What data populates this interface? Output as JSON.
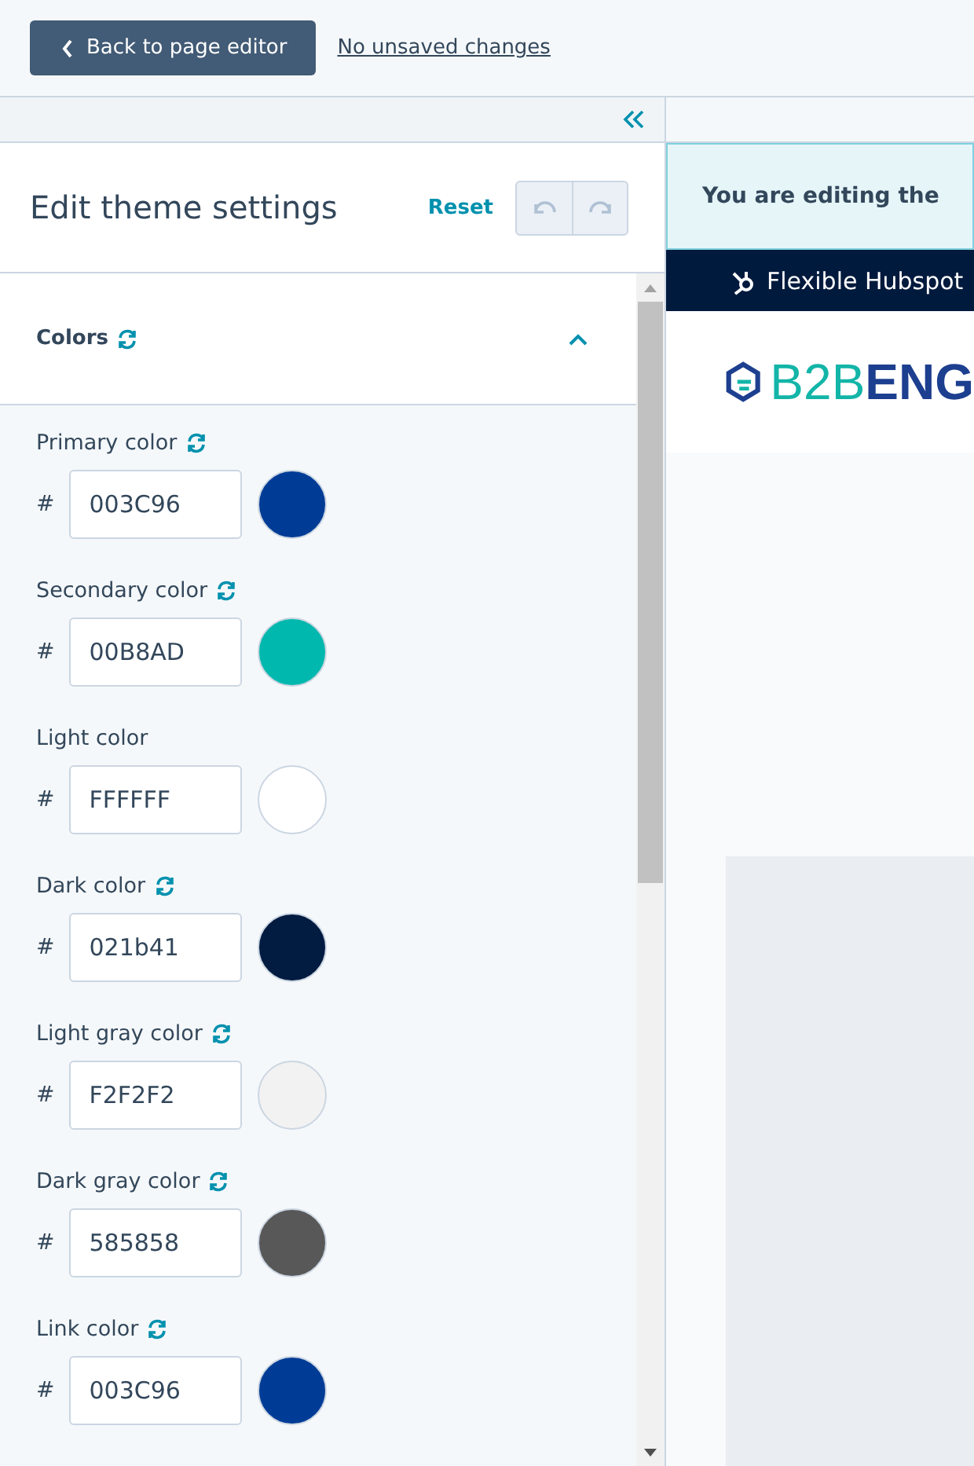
{
  "topbar": {
    "back_button": "Back to page editor",
    "status_link": "No unsaved changes"
  },
  "sidebar": {
    "title": "Edit theme settings",
    "reset": "Reset",
    "section": {
      "label": "Colors",
      "expanded": true
    },
    "settings": [
      {
        "label": "Primary color",
        "value": "003C96",
        "color": "#003c96",
        "resettable": true
      },
      {
        "label": "Secondary color",
        "value": "00B8AD",
        "color": "#00b8ad",
        "resettable": true
      },
      {
        "label": "Light color",
        "value": "FFFFFF",
        "color": "#ffffff",
        "resettable": false
      },
      {
        "label": "Dark color",
        "value": "021b41",
        "color": "#021b41",
        "resettable": true
      },
      {
        "label": "Light gray color",
        "value": "F2F2F2",
        "color": "#f2f2f2",
        "resettable": true
      },
      {
        "label": "Dark gray color",
        "value": "585858",
        "color": "#585858",
        "resettable": true
      },
      {
        "label": "Link color",
        "value": "003C96",
        "color": "#003c96",
        "resettable": true
      }
    ],
    "prefix": "#"
  },
  "preview": {
    "banner": "You are editing the",
    "bar_text": "Flexible Hubspot",
    "logo_light": "B2B",
    "logo_bold": "ENG"
  }
}
